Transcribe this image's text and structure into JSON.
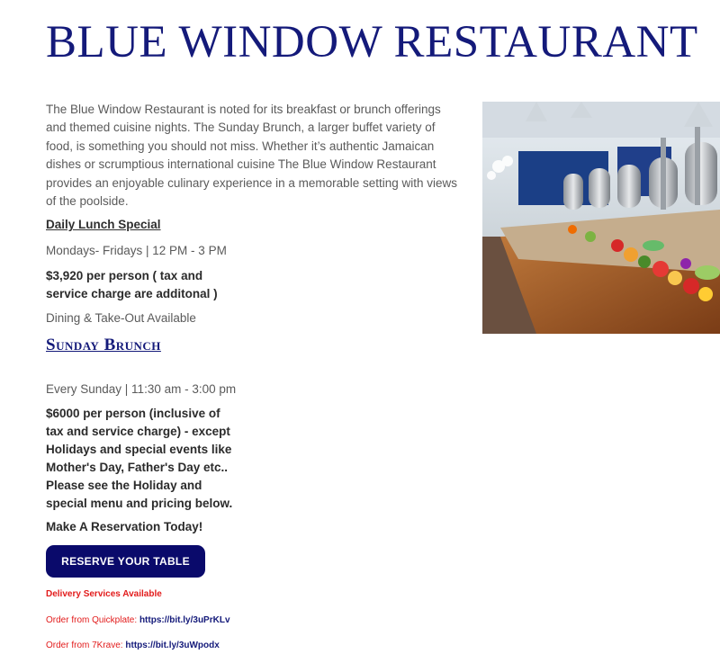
{
  "page": {
    "title": "BLUE WINDOW RESTAURANT",
    "intro": "The Blue Window Restaurant is noted for its breakfast or brunch offerings and themed cuisine nights. The Sunday Brunch, a larger buffet variety of food, is something you should not miss. Whether it’s authentic Jamaican dishes or scrumptious international cuisine The Blue Window Restaurant provides an enjoyable culinary experience in a memorable setting with views of the poolside."
  },
  "lunch": {
    "heading": "Daily Lunch Special",
    "hours": "Mondays- Fridays | 12 PM - 3 PM",
    "price_line1": "$3,920 per person ( tax and",
    "price_line2": "service charge are additonal )",
    "note": "Dining & Take-Out Available"
  },
  "brunch": {
    "heading": "Sunday Brunch",
    "hours": "Every Sunday | 11:30 am - 3:00 pm",
    "price_lines": [
      "$6000 per person (inclusive of",
      "tax and service charge)  - except",
      "Holidays and special events like",
      "Mother's Day, Father's Day etc..",
      "Please see the Holiday and",
      "special menu and pricing below."
    ]
  },
  "reservation": {
    "cta": "Make A Reservation Today!",
    "button": "RESERVE YOUR TABLE"
  },
  "delivery": {
    "heading": "Delivery Services Available",
    "quickplate_label": "Order from Quickplate:",
    "quickplate_link": "https://bit.ly/3uPrKLv",
    "sevenkrave_label": "Order from 7Krave:",
    "sevenkrave_link": "https://bit.ly/3uWpodx"
  },
  "colors": {
    "brand_navy": "#141a7a",
    "button_bg": "#0a0a6b",
    "delivery_red": "#e21b1b"
  }
}
